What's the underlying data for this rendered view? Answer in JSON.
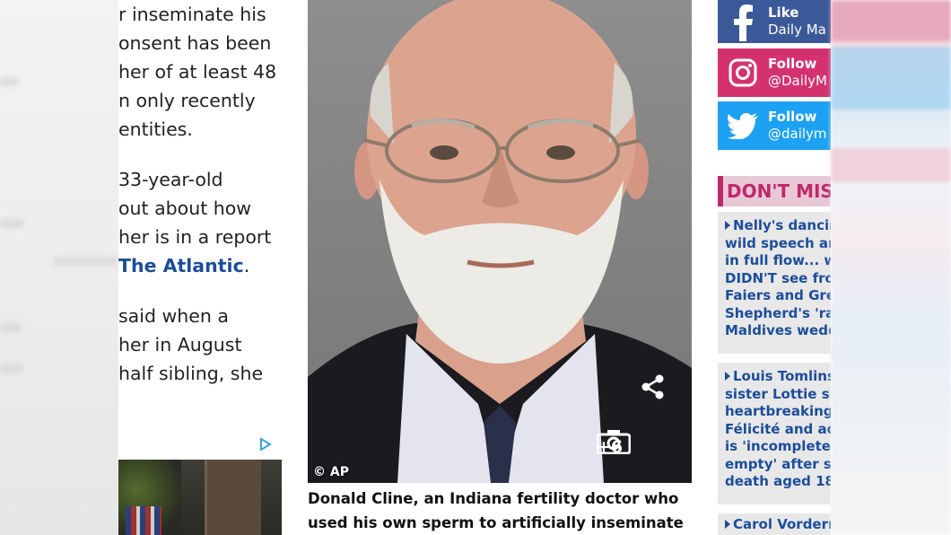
{
  "article": {
    "lines": [
      "r inseminate his",
      "onsent has been",
      "her of at least 48",
      "n only recently",
      "entities.",
      "33-year-old",
      "out about how",
      "her is in a report",
      "said when a",
      "her in August",
      "half sibling, she"
    ],
    "source_link": "The Atlantic",
    "source_suffix": "."
  },
  "photo": {
    "credit": "© AP",
    "gallery_count": "+6",
    "share_icon": "share-icon",
    "camera_icon": "camera-icon"
  },
  "caption": {
    "line1": "Donald Cline, an Indiana fertility doctor who",
    "line2": "used his own sperm to artificially inseminate"
  },
  "social": {
    "facebook": {
      "action": "Like",
      "handle": "Daily Ma",
      "color": "#3b5998"
    },
    "instagram": {
      "action": "Follow",
      "handle": "@DailyM",
      "color": "#d4326f"
    },
    "twitter": {
      "action": "Follow",
      "handle": "@dailym",
      "color": "#1da1f2"
    }
  },
  "dont_miss": {
    "heading": "DON'T MIS",
    "items": [
      {
        "lines": [
          "Nelly's dancin",
          "wild speech an",
          "in full flow... w",
          "DIDN'T see fro",
          "Faiers and Gre",
          "Shepherd's 'ra",
          "Maldives wedd"
        ]
      },
      {
        "lines": [
          "Louis Tomlins",
          "sister Lottie sh",
          "heartbreaking",
          "Félicité and adi",
          "is 'incomplete a",
          "empty' after sib",
          "death aged 18"
        ]
      },
      {
        "lines": [
          "Carol Vorderm"
        ]
      }
    ]
  },
  "colors": {
    "link": "#1c4d9c",
    "accent": "#c0286d"
  }
}
